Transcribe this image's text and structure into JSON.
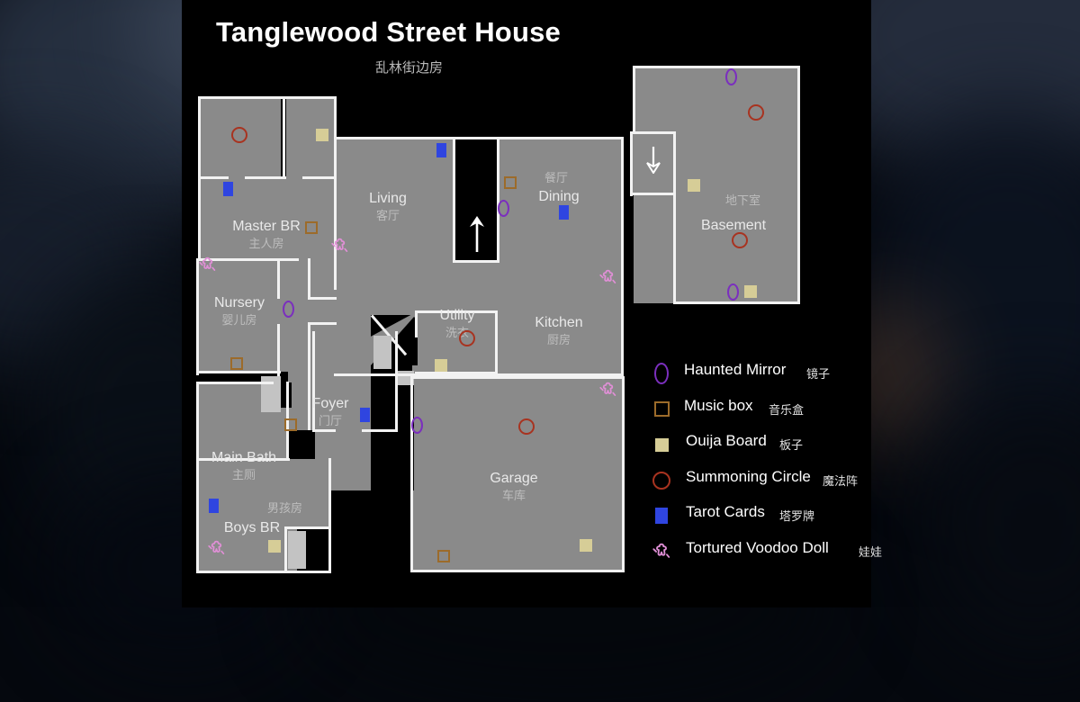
{
  "header": {
    "title": "Tanglewood Street House",
    "subtitle": "乱林街边房"
  },
  "rooms": [
    {
      "en": "Master BR",
      "cn": "主人房"
    },
    {
      "en": "Nursery",
      "cn": "婴儿房"
    },
    {
      "en": "Main Bath",
      "cn": "主厕"
    },
    {
      "en": "Boys BR",
      "cn": "男孩房"
    },
    {
      "en": "Foyer",
      "cn": "门厅"
    },
    {
      "en": "Living",
      "cn": "客厅"
    },
    {
      "en": "Dining",
      "cn": "餐厅"
    },
    {
      "en": "Utility",
      "cn": "洗衣"
    },
    {
      "en": "Kitchen",
      "cn": "厨房"
    },
    {
      "en": "Garage",
      "cn": "车库"
    },
    {
      "en": "Basement",
      "cn": "地下室"
    }
  ],
  "legend": {
    "items": [
      {
        "icon": "haunted-mirror-icon",
        "en": "Haunted Mirror",
        "cn": "镜子",
        "color": "#7b2fbe"
      },
      {
        "icon": "music-box-icon",
        "en": "Music box",
        "cn": "音乐盒",
        "color": "#9c6b2a"
      },
      {
        "icon": "ouija-board-icon",
        "en": "Ouija Board",
        "cn": "板子",
        "color": "#d6cd97"
      },
      {
        "icon": "summoning-circle-icon",
        "en": "Summoning Circle",
        "cn": "魔法阵",
        "color": "#a83320"
      },
      {
        "icon": "tarot-cards-icon",
        "en": "Tarot Cards",
        "cn": "塔罗牌",
        "color": "#2f45e0"
      },
      {
        "icon": "voodoo-doll-icon",
        "en": "Tortured Voodoo Doll",
        "cn": "娃娃",
        "color": "#e08fd6"
      }
    ]
  },
  "palette": {
    "panel_bg": "#000000",
    "room_fill": "#8a8a8a",
    "wall": "#f2f2f2",
    "door": "#c3c3c3",
    "label_en": "#e9e9e9",
    "label_cn": "#bdbdbd"
  },
  "stairs": [
    {
      "name": "main-floor-stair-up",
      "direction": "up"
    },
    {
      "name": "basement-stair-down",
      "direction": "down"
    }
  ]
}
